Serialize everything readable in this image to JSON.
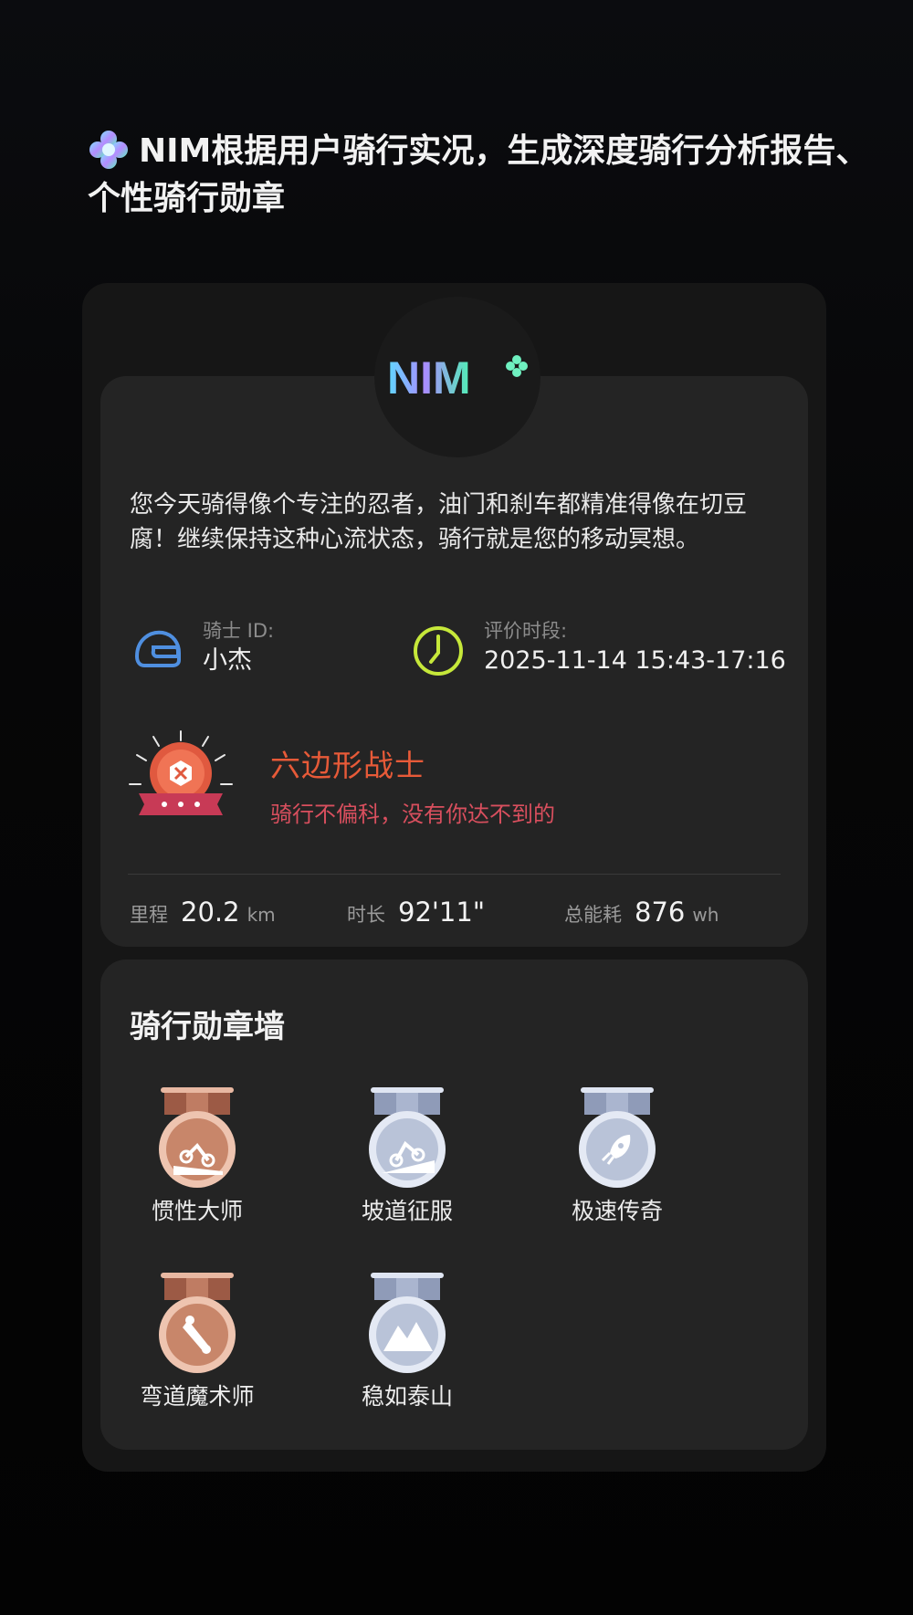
{
  "headline": {
    "text": "NIM根据用户骑行实况，生成深度骑行分析报告、个性骑行勋章",
    "icon": "sparkle-icon"
  },
  "report": {
    "logo_text": "NIM",
    "summary": "您今天骑得像个专注的忍者，油门和刹车都精准得像在切豆腐！继续保持这种心流状态，骑行就是您的移动冥想。",
    "rider_label": "骑士 ID:",
    "rider_value": "小杰",
    "time_label": "评价时段:",
    "time_value": "2025-11-14 15:43-17:16",
    "badge": {
      "title": "六边形战士",
      "subtitle": "骑行不偏科，没有你达不到的",
      "icon": "hexagon-warrior-badge-icon"
    },
    "stats": [
      {
        "key": "里程",
        "value": "20.2",
        "unit": "km"
      },
      {
        "key": "时长",
        "value": "92'11\"",
        "unit": ""
      },
      {
        "key": "总能耗",
        "value": "876",
        "unit": "wh"
      }
    ]
  },
  "medal_wall": {
    "title": "骑行勋章墙",
    "medals": [
      {
        "name": "惯性大师",
        "tier": "bronze",
        "icon": "motorbike-downhill-icon"
      },
      {
        "name": "坡道征服",
        "tier": "silver",
        "icon": "motorbike-uphill-icon"
      },
      {
        "name": "极速传奇",
        "tier": "silver",
        "icon": "rocket-icon"
      },
      {
        "name": "弯道魔术师",
        "tier": "bronze",
        "icon": "motorbike-lean-icon"
      },
      {
        "name": "稳如泰山",
        "tier": "silver",
        "icon": "mountain-icon"
      }
    ]
  },
  "colors": {
    "accent_red": "#e75a38",
    "accent_pink": "#d94f5e",
    "bronze": "#c8866a",
    "silver": "#b9c3d8"
  }
}
